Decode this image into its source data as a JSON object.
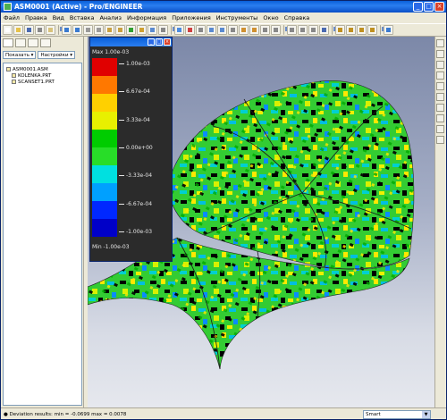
{
  "window": {
    "title": "ASM0001 (Active) - Pro/ENGINEER"
  },
  "menu": [
    "Файл",
    "Правка",
    "Вид",
    "Вставка",
    "Анализ",
    "Информация",
    "Приложения",
    "Инструменты",
    "Окно",
    "Справка"
  ],
  "left_panel": {
    "show_button": "Показать ▾",
    "settings_button": "Настройки ▾",
    "tree": [
      {
        "label": "ASM0001.ASM",
        "child": false
      },
      {
        "label": "KOLENKA.PRT",
        "child": true
      },
      {
        "label": "SCANSET1.PRT",
        "child": true
      }
    ]
  },
  "legend": {
    "max_label": "Max  1.00e-03",
    "min_label": "Min -1.00e-03",
    "ticks": [
      "1.00e-03",
      "6.67e-04",
      "3.33e-04",
      "0.00e+00",
      "-3.33e-04",
      "-6.67e-04",
      "-1.00e-03"
    ],
    "colors": [
      "#e00000",
      "#ff7800",
      "#ffd000",
      "#e8f000",
      "#00cc00",
      "#28dd28",
      "#00e0e0",
      "#00a0ff",
      "#0028ff",
      "#0000c8"
    ]
  },
  "status": {
    "text": "● Deviation results:  min = -0.0699  max = 0.0078",
    "filter": "Smart"
  }
}
